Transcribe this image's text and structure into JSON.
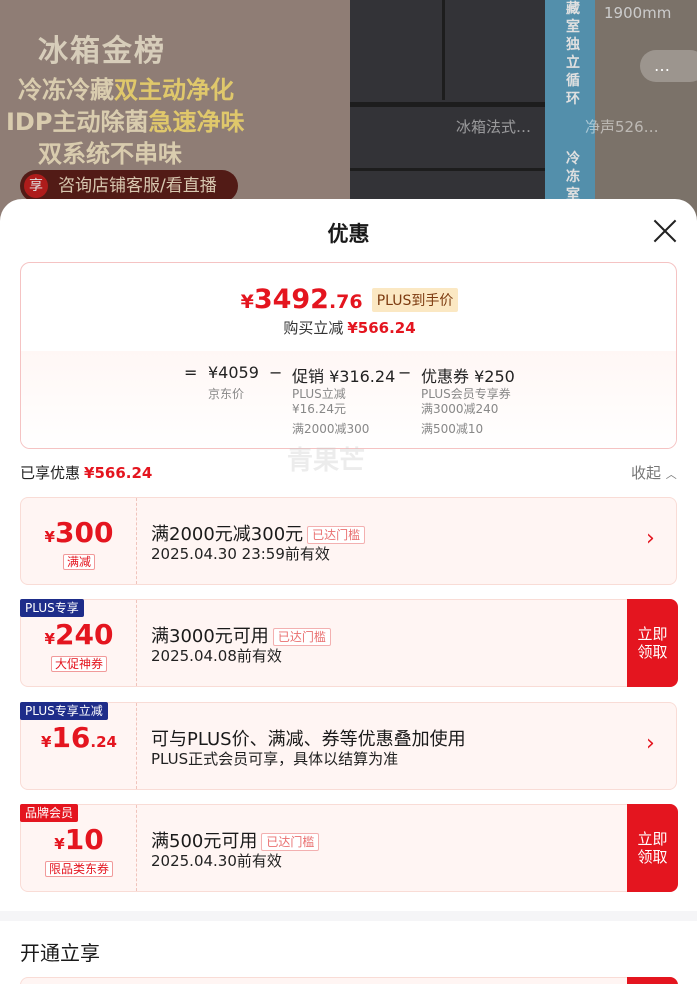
{
  "background": {
    "banner_title": "冰箱金榜",
    "banner_line1_a": "冷冻冷藏",
    "banner_line1_b": "双主动净化",
    "banner_line2_a": "IDP主动除菌",
    "banner_line2_b": "急速净味",
    "banner_line3": "双系统不串味",
    "consult_icon": "享",
    "consult_text": "咨询店铺客服/看直播",
    "side_text_top": "藏室独立循环",
    "side_text_bottom": "冷冻室",
    "height_label": "1900mm",
    "tab_left": "冰箱法式…",
    "tab_right": "净声526…",
    "more_dots": "…"
  },
  "sheet": {
    "title": "优惠",
    "summary": {
      "currency": "¥",
      "price_int": "3492",
      "price_dec": ".76",
      "plus_label": "PLUS到手价",
      "reduce_label": "购买立减",
      "reduce_value": "¥566.24",
      "formula": {
        "equals": "=",
        "jd_price": "¥4059",
        "jd_label": "京东价",
        "minus1": "−",
        "promo": "促销 ¥316.24",
        "promo_sub1": "PLUS立减",
        "promo_sub2": "¥16.24元",
        "promo_sub3": "满2000减300",
        "minus2": "−",
        "coupon": "优惠券 ¥250",
        "coupon_sub1": "PLUS会员专享券",
        "coupon_sub2": "满3000减240",
        "coupon_sub3": "满500减10"
      }
    },
    "enjoyed_label": "已享优惠",
    "enjoyed_value": "¥566.24",
    "collapse_label": "收起",
    "watermark": "青果芒",
    "coupons": [
      {
        "corner": "",
        "symbol": "¥",
        "amount": "300",
        "decimal": "",
        "tag": "满减",
        "title": "满2000元减300元",
        "chip": "已达门槛",
        "desc": "2025.04.30 23:59前有效",
        "action": "chevron"
      },
      {
        "corner": "PLUS专享",
        "symbol": "¥",
        "amount": "240",
        "decimal": "",
        "tag": "大促神券",
        "title": "满3000元可用",
        "chip": "已达门槛",
        "desc": "2025.04.08前有效",
        "action_line1": "立即",
        "action_line2": "领取"
      },
      {
        "corner": "PLUS专享立减",
        "symbol": "¥",
        "amount": "16",
        "decimal": ".24",
        "tag": "",
        "title": "可与PLUS价、满减、券等优惠叠加使用",
        "chip": "",
        "desc": "PLUS正式会员可享，具体以结算为准",
        "action": "chevron"
      },
      {
        "corner": "品牌会员",
        "symbol": "¥",
        "amount": "10",
        "decimal": "",
        "tag": "限品类东券",
        "title": "满500元可用",
        "chip": "已达门槛",
        "desc": "2025.04.30前有效",
        "action_line1": "立即",
        "action_line2": "领取"
      }
    ],
    "section2_title": "开通立享"
  },
  "colors": {
    "accent_red": "#e4151f",
    "plus_navy": "#1e2d8a",
    "plus_gold_bg": "#fbe8c3"
  }
}
